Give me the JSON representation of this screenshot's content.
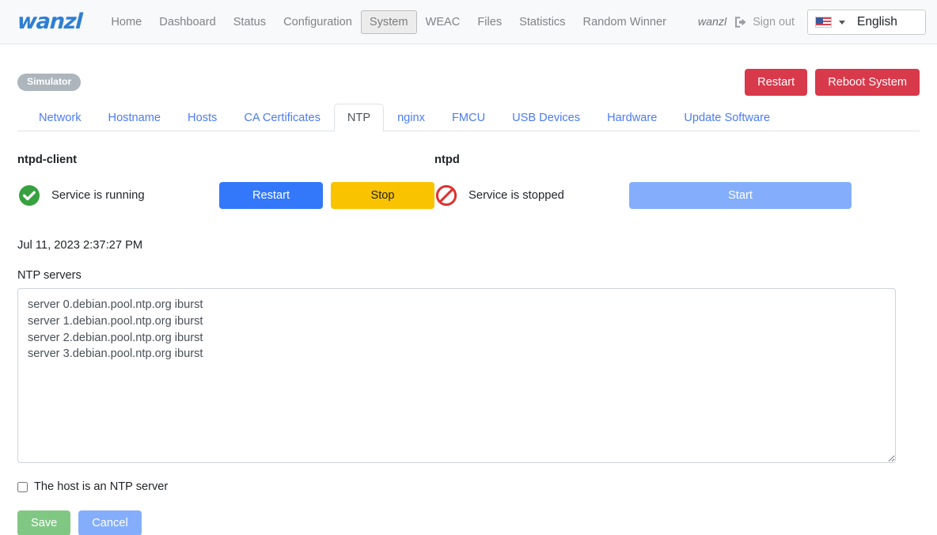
{
  "header": {
    "brand": "wanzl",
    "nav_items": [
      {
        "label": "Home",
        "active": false
      },
      {
        "label": "Dashboard",
        "active": false
      },
      {
        "label": "Status",
        "active": false
      },
      {
        "label": "Configuration",
        "active": false
      },
      {
        "label": "System",
        "active": true
      },
      {
        "label": "WEAC",
        "active": false
      },
      {
        "label": "Files",
        "active": false
      },
      {
        "label": "Statistics",
        "active": false
      },
      {
        "label": "Random Winner",
        "active": false
      }
    ],
    "user_name": "wanzl",
    "signout_label": "Sign out",
    "signout_icon": "sign-out-icon",
    "language": {
      "selected": "English",
      "flag": "us-flag-icon",
      "caret": "chevron-down-icon"
    }
  },
  "page": {
    "badge": "Simulator",
    "actions": [
      {
        "label": "Restart",
        "style": "danger"
      },
      {
        "label": "Reboot System",
        "style": "danger"
      }
    ]
  },
  "tabs": [
    {
      "label": "Network",
      "active": false
    },
    {
      "label": "Hostname",
      "active": false
    },
    {
      "label": "Hosts",
      "active": false
    },
    {
      "label": "CA Certificates",
      "active": false
    },
    {
      "label": "NTP",
      "active": true
    },
    {
      "label": "nginx",
      "active": false
    },
    {
      "label": "FMCU",
      "active": false
    },
    {
      "label": "USB Devices",
      "active": false
    },
    {
      "label": "Hardware",
      "active": false
    },
    {
      "label": "Update Software",
      "active": false
    }
  ],
  "services": [
    {
      "title": "ntpd-client",
      "status_text": "Service is running",
      "status_icon": "check-circle-icon",
      "buttons": [
        {
          "label": "Restart",
          "style": "primary"
        },
        {
          "label": "Stop",
          "style": "warning"
        }
      ]
    },
    {
      "title": "ntpd",
      "status_text": "Service is stopped",
      "status_icon": "prohibited-icon",
      "buttons": [
        {
          "label": "Start",
          "style": "start"
        }
      ]
    }
  ],
  "form": {
    "timestamp": "Jul 11, 2023 2:37:27 PM",
    "ntp_servers_label": "NTP servers",
    "ntp_servers_value": "server 0.debian.pool.ntp.org iburst\nserver 1.debian.pool.ntp.org iburst\nserver 2.debian.pool.ntp.org iburst\nserver 3.debian.pool.ntp.org iburst",
    "ntp_servers_placeholder": "",
    "host_is_ntp_server_label": "The host is an NTP server",
    "host_is_ntp_server_checked": false,
    "save_label": "Save",
    "cancel_label": "Cancel"
  },
  "colors": {
    "brand_blue": "#2e7fd4",
    "link_blue": "#4b7bf5",
    "danger_red": "#d8394b",
    "primary_blue": "#3377fb",
    "warning_yellow": "#f9c300",
    "light_blue": "#84aefb",
    "save_green": "#81c784",
    "badge_gray": "#adb5bd",
    "status_ok_green": "#37a13f",
    "status_stop_red": "#e03030"
  }
}
